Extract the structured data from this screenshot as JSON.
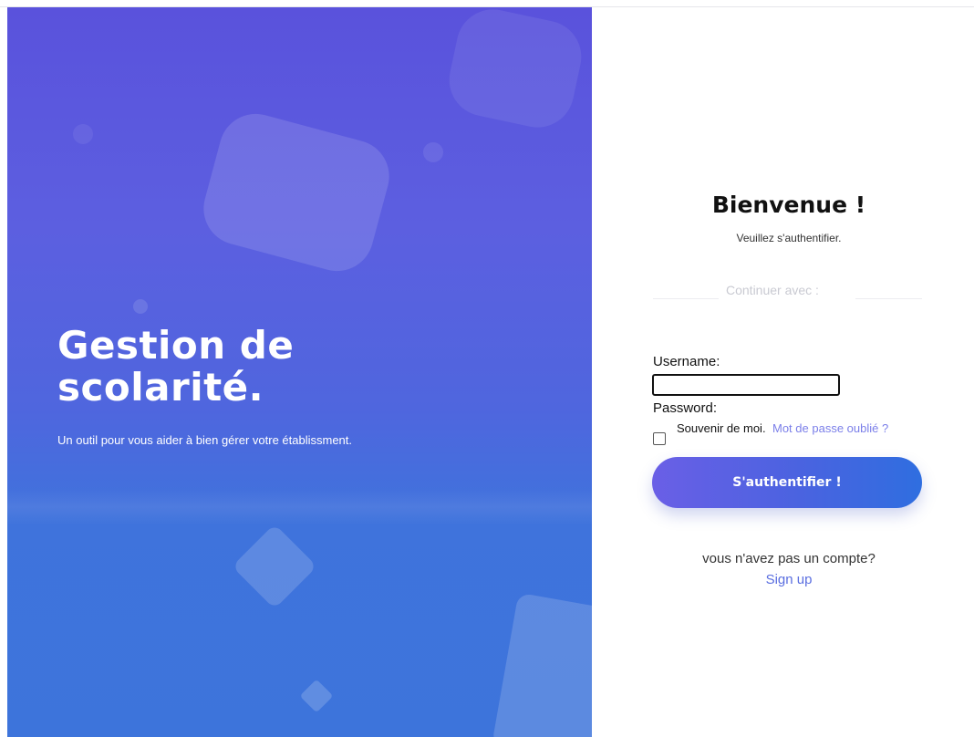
{
  "hero": {
    "title": "Gestion de scolarité.",
    "subtitle": "Un outil pour vous aider à bien gérer votre établissment."
  },
  "form": {
    "welcome_title": "Bienvenue !",
    "welcome_subtitle": "Veuillez s'authentifier.",
    "continue_with": "Continuer avec :",
    "username_label": "Username:",
    "username_value": "",
    "password_label": "Password:",
    "remember_label": "Souvenir de moi.",
    "remember_checked": false,
    "forgot_link": "Mot de passe oublié ?",
    "submit_label": "S'authentifier !",
    "no_account_text": "vous n'avez pas un compte?",
    "signup_link": "Sign up"
  },
  "colors": {
    "hero_gradient_top": "#5a52dc",
    "hero_gradient_bottom": "#3d74db",
    "button_gradient_start": "#6a5fe6",
    "button_gradient_end": "#2f6ee0",
    "link": "#7b7fe9"
  }
}
